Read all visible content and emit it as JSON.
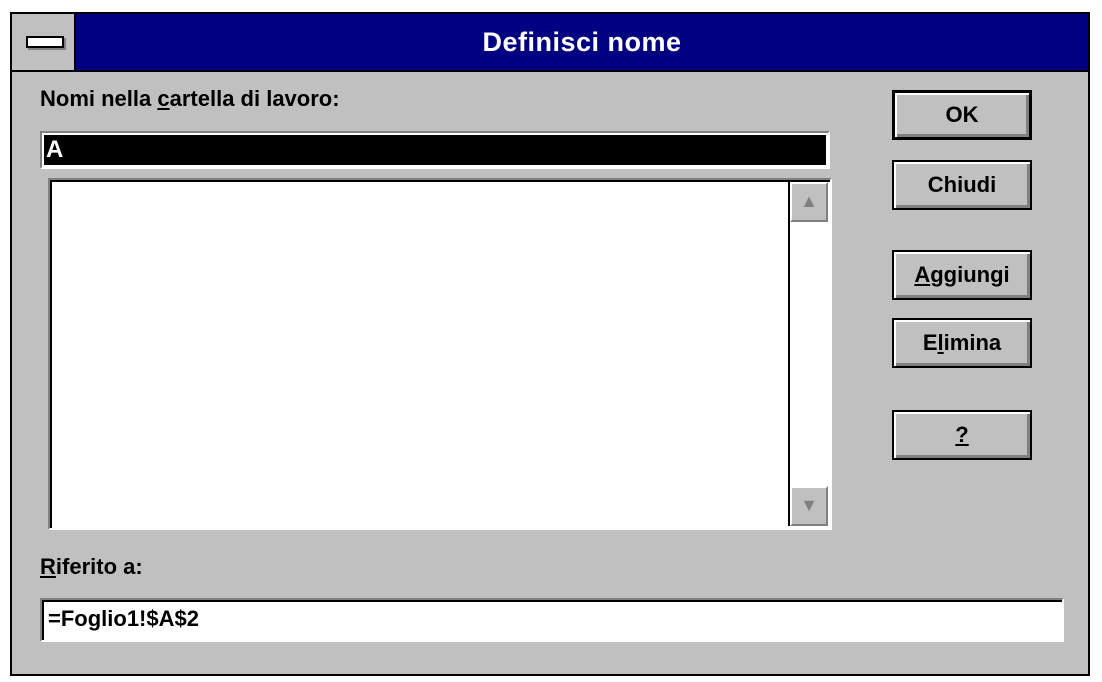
{
  "window": {
    "title": "Definisci nome"
  },
  "names_label": {
    "before": "Nomi nella ",
    "mnemonic": "c",
    "after": "artella di lavoro:"
  },
  "name_input": {
    "value": "A"
  },
  "names_list": {
    "items": []
  },
  "buttons": {
    "ok": "OK",
    "close": "Chiudi",
    "add": {
      "mnemonic": "A",
      "rest": "ggiungi"
    },
    "delete": {
      "before": "E",
      "mnemonic": "l",
      "rest": "imina"
    },
    "help": "?"
  },
  "ref_label": {
    "mnemonic": "R",
    "rest": "iferito a:"
  },
  "ref_input": {
    "value": "=Foglio1!$A$2"
  },
  "icons": {
    "system_menu": "system-menu-icon",
    "scroll_up": "scroll-up-arrow-icon",
    "scroll_down": "scroll-down-arrow-icon"
  },
  "colors": {
    "titlebar": "#000080",
    "dialog_bg": "#c0c0c0",
    "selection_bg": "#000000",
    "selection_fg": "#ffffff"
  }
}
